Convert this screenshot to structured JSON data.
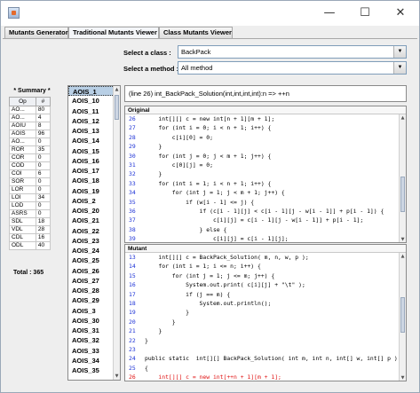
{
  "window": {
    "controls": {
      "minimize": "—",
      "maximize": "☐",
      "close": "✕"
    }
  },
  "tabs": [
    "Mutants Generator",
    "Traditional Mutants Viewer",
    "Class Mutants Viewer"
  ],
  "class_select": {
    "label": "Select a class :",
    "value": "BackPack"
  },
  "method_select": {
    "label": "Select a method :",
    "value": "All method"
  },
  "summary": {
    "title": "* Summary *",
    "headers": [
      "Op",
      "#"
    ],
    "rows": [
      [
        "AO...",
        "80"
      ],
      [
        "AO...",
        "4"
      ],
      [
        "AOIU",
        "8"
      ],
      [
        "AOIS",
        "96"
      ],
      [
        "AO...",
        "0"
      ],
      [
        "ROR",
        "35"
      ],
      [
        "COR",
        "0"
      ],
      [
        "COD",
        "0"
      ],
      [
        "COI",
        "6"
      ],
      [
        "SOR",
        "0"
      ],
      [
        "LOR",
        "0"
      ],
      [
        "LOI",
        "34"
      ],
      [
        "LOD",
        "0"
      ],
      [
        "ASRS",
        "0"
      ],
      [
        "SDL",
        "18"
      ],
      [
        "VDL",
        "28"
      ],
      [
        "CDL",
        "16"
      ],
      [
        "ODL",
        "40"
      ]
    ],
    "total": "Total : 365"
  },
  "mutant_list": [
    "AOIS_1",
    "AOIS_10",
    "AOIS_11",
    "AOIS_12",
    "AOIS_13",
    "AOIS_14",
    "AOIS_15",
    "AOIS_16",
    "AOIS_17",
    "AOIS_18",
    "AOIS_19",
    "AOIS_2",
    "AOIS_20",
    "AOIS_21",
    "AOIS_22",
    "AOIS_23",
    "AOIS_24",
    "AOIS_25",
    "AOIS_26",
    "AOIS_27",
    "AOIS_28",
    "AOIS_29",
    "AOIS_3",
    "AOIS_30",
    "AOIS_31",
    "AOIS_32",
    "AOIS_33",
    "AOIS_34",
    "AOIS_35"
  ],
  "selected_mutant": "AOIS_1",
  "description": "(line 26) int_BackPack_Solution(int,int,int,int):n => ++n",
  "original": {
    "title": "Original",
    "lines": [
      {
        "n": "26",
        "code": "    int[][] c = new int[n + 1][m + 1];"
      },
      {
        "n": "27",
        "code": "    for (int i = 0; i < n + 1; i++) {"
      },
      {
        "n": "28",
        "code": "        c[i][0] = 0;"
      },
      {
        "n": "29",
        "code": "    }"
      },
      {
        "n": "30",
        "code": "    for (int j = 0; j < m + 1; j++) {"
      },
      {
        "n": "31",
        "code": "        c[0][j] = 0;"
      },
      {
        "n": "32",
        "code": "    }"
      },
      {
        "n": "33",
        "code": "    for (int i = 1; i < n + 1; i++) {"
      },
      {
        "n": "34",
        "code": "        for (int j = 1; j < m + 1; j++) {"
      },
      {
        "n": "35",
        "code": "            if (w[i - 1] <= j) {"
      },
      {
        "n": "36",
        "code": "                if (c[i - 1][j] < c[i - 1][j - w[i - 1]] + p[i - 1]) {"
      },
      {
        "n": "37",
        "code": "                    c[i][j] = c[i - 1][j - w[i - 1]] + p[i - 1];"
      },
      {
        "n": "38",
        "code": "                } else {"
      },
      {
        "n": "39",
        "code": "                    c[i][j] = c[i - 1][j];"
      }
    ]
  },
  "mutant": {
    "title": "Mutant",
    "lines": [
      {
        "n": "13",
        "code": "    int[][] c = BackPack_Solution( m, n, w, p );",
        "changed": false
      },
      {
        "n": "14",
        "code": "    for (int i = 1; i <= n; i++) {",
        "changed": false
      },
      {
        "n": "15",
        "code": "        for (int j = 1; j <= m; j++) {",
        "changed": false
      },
      {
        "n": "16",
        "code": "            System.out.print( c[i][j] + \"\\t\" );",
        "changed": false
      },
      {
        "n": "17",
        "code": "            if (j == m) {",
        "changed": false
      },
      {
        "n": "18",
        "code": "                System.out.println();",
        "changed": false
      },
      {
        "n": "19",
        "code": "            }",
        "changed": false
      },
      {
        "n": "20",
        "code": "        }",
        "changed": false
      },
      {
        "n": "21",
        "code": "    }",
        "changed": false
      },
      {
        "n": "22",
        "code": "}",
        "changed": false
      },
      {
        "n": "23",
        "code": "",
        "changed": false
      },
      {
        "n": "24",
        "code": "public static  int[][] BackPack_Solution( int m, int n, int[] w, int[] p )",
        "changed": false
      },
      {
        "n": "25",
        "code": "{",
        "changed": false
      },
      {
        "n": "26",
        "code": "    int[][] c = new int[++n + 1][m + 1];",
        "changed": true
      }
    ]
  }
}
